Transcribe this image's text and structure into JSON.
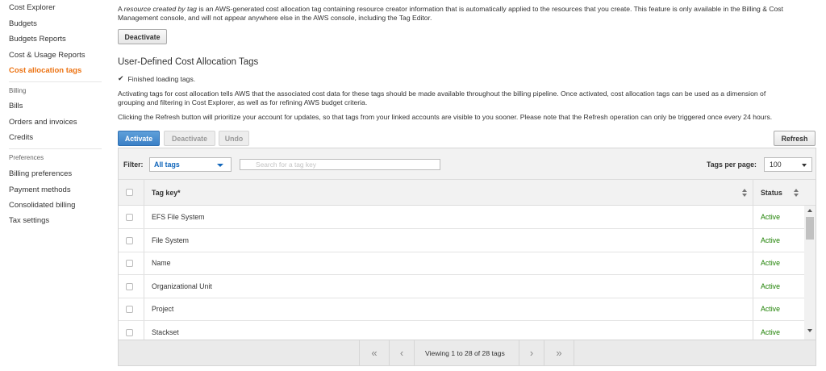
{
  "sidebar": {
    "items_top": [
      {
        "label": "Cost Explorer",
        "active": false
      },
      {
        "label": "Budgets",
        "active": false
      },
      {
        "label": "Budgets Reports",
        "active": false
      },
      {
        "label": "Cost & Usage Reports",
        "active": false
      },
      {
        "label": "Cost allocation tags",
        "active": true
      }
    ],
    "billing_section": "Billing",
    "billing_items": [
      {
        "label": "Bills"
      },
      {
        "label": "Orders and invoices"
      },
      {
        "label": "Credits"
      }
    ],
    "preferences_section": "Preferences",
    "preferences_items": [
      {
        "label": "Billing preferences"
      },
      {
        "label": "Payment methods"
      },
      {
        "label": "Consolidated billing"
      },
      {
        "label": "Tax settings"
      }
    ]
  },
  "intro": {
    "line1_prefix": "A ",
    "line1_italic": "resource created by tag",
    "line1_rest": " is an AWS-generated cost allocation tag containing resource creator information that is automatically applied to the resources that you create. This feature is only available in the Billing & Cost",
    "line2": "Management console, and will not appear anywhere else in the AWS console, including the Tag Editor.",
    "deactivate_label": "Deactivate"
  },
  "section": {
    "title": "User-Defined Cost Allocation Tags",
    "loaded_text": "Finished loading tags.",
    "desc_line1": "Activating tags for cost allocation tells AWS that the associated cost data for these tags should be made available throughout the billing pipeline. Once activated, cost allocation tags can be used as a dimension of",
    "desc_line2": "grouping and filtering in Cost Explorer, as well as for refining AWS budget criteria.",
    "refresh_note": "Clicking the Refresh button will prioritize your account for updates, so that tags from your linked accounts are visible to you sooner. Please note that the Refresh operation can only be triggered once every 24 hours."
  },
  "actions": {
    "activate": "Activate",
    "deactivate": "Deactivate",
    "undo": "Undo",
    "refresh": "Refresh"
  },
  "filter": {
    "label": "Filter:",
    "selected": "All tags",
    "search_placeholder": "Search for a tag key",
    "per_page_label": "Tags per page:",
    "per_page_value": "100"
  },
  "table": {
    "col_key": "Tag key*",
    "col_status": "Status",
    "rows": [
      {
        "key": "EFS File System",
        "status": "Active"
      },
      {
        "key": "File System",
        "status": "Active"
      },
      {
        "key": "Name",
        "status": "Active"
      },
      {
        "key": "Organizational Unit",
        "status": "Active"
      },
      {
        "key": "Project",
        "status": "Active"
      },
      {
        "key": "Stackset",
        "status": "Active"
      }
    ]
  },
  "pager": {
    "first": "«",
    "prev": "‹",
    "info": "Viewing 1 to 28 of 28 tags",
    "next": "›",
    "last": "»"
  },
  "colors": {
    "accent_active_nav": "#ec7211",
    "primary_button": "#3b80c6",
    "status_active": "#1d8102",
    "link_blue": "#1166bb"
  }
}
